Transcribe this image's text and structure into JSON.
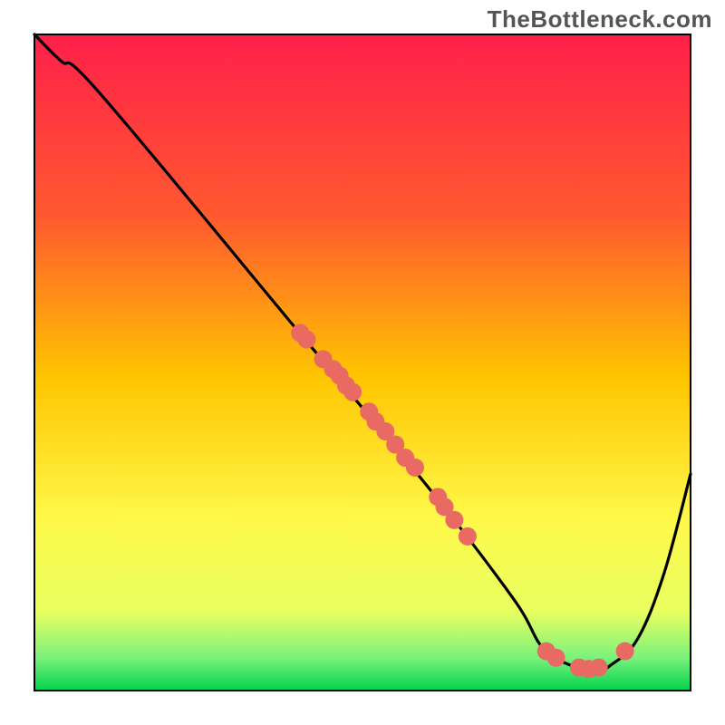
{
  "watermark": "TheBottleneck.com",
  "chart_data": {
    "type": "line",
    "title": "",
    "xlabel": "",
    "ylabel": "",
    "xlim": [
      0,
      100
    ],
    "ylim": [
      0,
      100
    ],
    "grid": false,
    "legend": false,
    "gradient_stops": [
      {
        "offset": 0,
        "color": "#ff1f4a"
      },
      {
        "offset": 28,
        "color": "#ff5a2f"
      },
      {
        "offset": 52,
        "color": "#ffc400"
      },
      {
        "offset": 74,
        "color": "#fff94a"
      },
      {
        "offset": 88,
        "color": "#e8ff60"
      },
      {
        "offset": 95,
        "color": "#7bf27b"
      },
      {
        "offset": 100,
        "color": "#00d24d"
      }
    ],
    "series": [
      {
        "name": "curve",
        "color": "#000000",
        "x": [
          0,
          4,
          10,
          40,
          60,
          73,
          78,
          85,
          88,
          92,
          96,
          100
        ],
        "y": [
          100,
          96,
          91,
          55,
          31,
          14,
          6,
          3,
          4,
          8,
          18,
          33
        ]
      }
    ],
    "points": {
      "color": "#e86a63",
      "r": 10,
      "items": [
        {
          "x": 40.5,
          "y": 54.5
        },
        {
          "x": 41.5,
          "y": 53.5
        },
        {
          "x": 44.0,
          "y": 50.5
        },
        {
          "x": 45.5,
          "y": 49.0
        },
        {
          "x": 46.5,
          "y": 48.0
        },
        {
          "x": 47.5,
          "y": 46.5
        },
        {
          "x": 48.5,
          "y": 45.5
        },
        {
          "x": 51.0,
          "y": 42.5
        },
        {
          "x": 52.0,
          "y": 41.0
        },
        {
          "x": 53.5,
          "y": 39.5
        },
        {
          "x": 55.0,
          "y": 37.5
        },
        {
          "x": 56.5,
          "y": 35.5
        },
        {
          "x": 58.0,
          "y": 34.0
        },
        {
          "x": 61.5,
          "y": 29.5
        },
        {
          "x": 62.5,
          "y": 28.0
        },
        {
          "x": 64.0,
          "y": 26.0
        },
        {
          "x": 66.0,
          "y": 23.5
        },
        {
          "x": 78.0,
          "y": 6.0
        },
        {
          "x": 79.5,
          "y": 5.0
        },
        {
          "x": 83.0,
          "y": 3.5
        },
        {
          "x": 84.5,
          "y": 3.3
        },
        {
          "x": 86.0,
          "y": 3.5
        },
        {
          "x": 90.0,
          "y": 6.0
        }
      ]
    },
    "background": "vertical-gradient"
  }
}
